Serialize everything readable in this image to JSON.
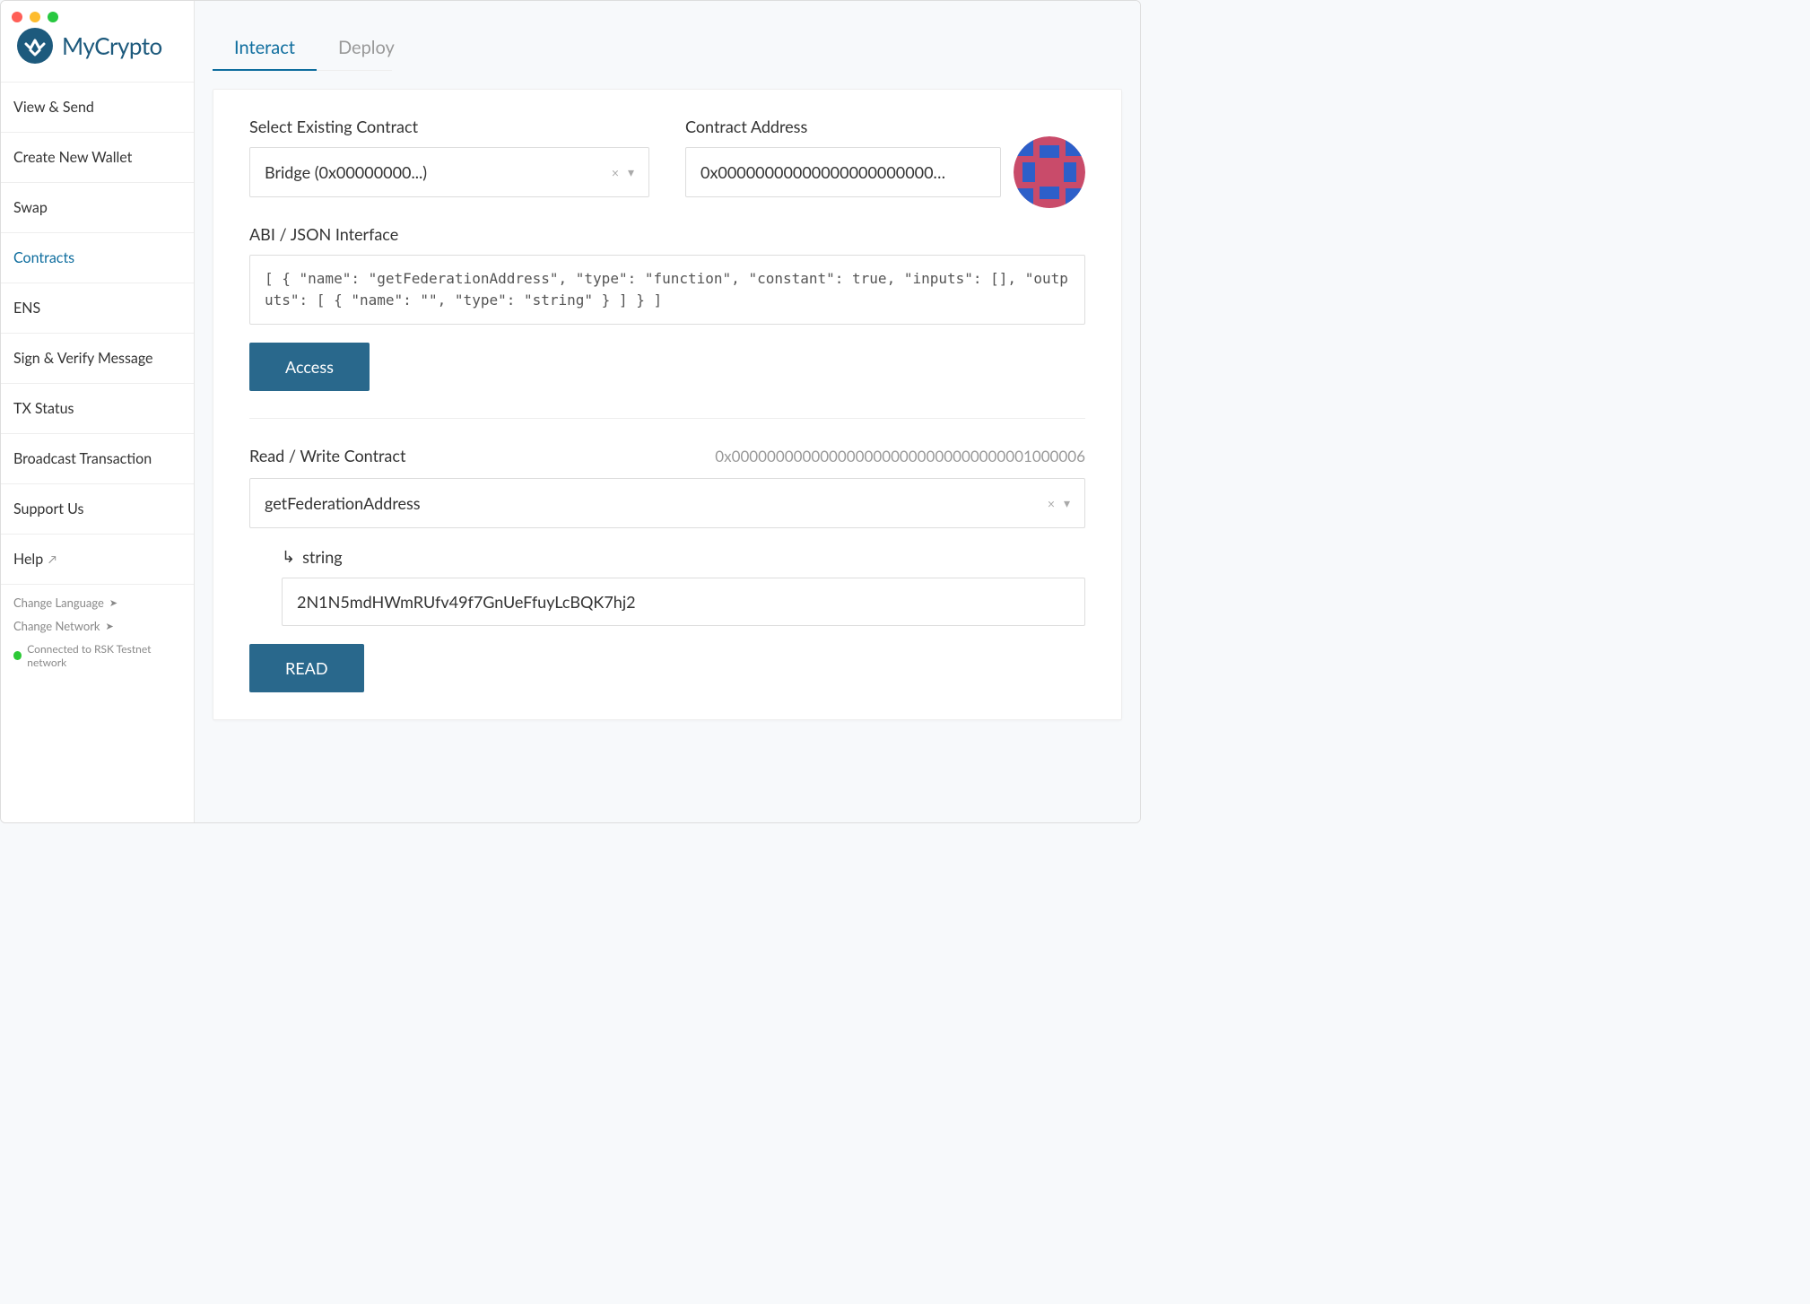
{
  "app": {
    "name": "MyCrypto"
  },
  "sidebar": {
    "items": [
      {
        "label": "View & Send"
      },
      {
        "label": "Create New Wallet"
      },
      {
        "label": "Swap"
      },
      {
        "label": "Contracts"
      },
      {
        "label": "ENS"
      },
      {
        "label": "Sign & Verify Message"
      },
      {
        "label": "TX Status"
      },
      {
        "label": "Broadcast Transaction"
      },
      {
        "label": "Support Us"
      },
      {
        "label": "Help"
      }
    ],
    "footer": {
      "language": "Change Language",
      "network": "Change Network",
      "status": "Connected to RSK Testnet network"
    }
  },
  "tabs": {
    "interact": "Interact",
    "deploy": "Deploy"
  },
  "contract": {
    "select_label": "Select Existing Contract",
    "select_value": "Bridge (0x00000000...)",
    "address_label": "Contract Address",
    "address_value": "0x00000000000000000000000…",
    "abi_label": "ABI / JSON Interface",
    "abi_value": "[ { \"name\": \"getFederationAddress\", \"type\": \"function\", \"constant\": true, \"inputs\": [], \"outputs\": [ { \"name\": \"\", \"type\": \"string\" } ] } ]",
    "access_button": "Access"
  },
  "readwrite": {
    "label": "Read / Write Contract",
    "address": "0x0000000000000000000000000000000001000006",
    "function": "getFederationAddress",
    "output_type": "string",
    "output_value": "2N1N5mdHWmRUfv49f7GnUeFfuyLcBQK7hj2",
    "read_button": "READ"
  }
}
